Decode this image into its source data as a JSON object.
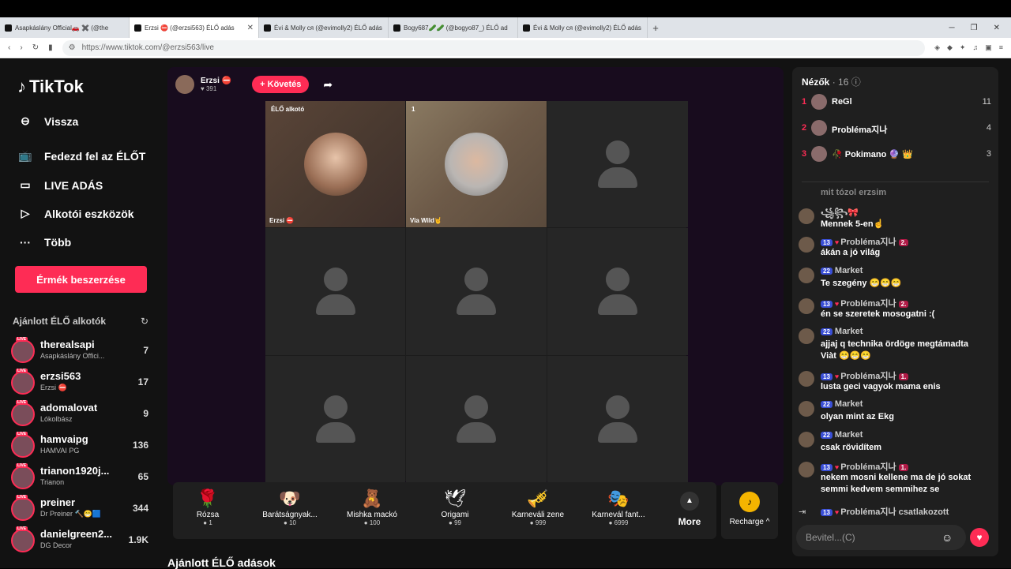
{
  "tabs": [
    {
      "title": "Asapkáslány Official🚗 ✖️ (@the"
    },
    {
      "title": "Erzsi ⛔ (@erzsi563) ÉLŐ adás"
    },
    {
      "title": "Évi & Molly ся (@evimolly2) ÉLŐ adás"
    },
    {
      "title": "Bogy687🥒🥒 (@bogyo87_) ÉLŐ ad"
    },
    {
      "title": "Évi & Molly ся (@evimolly2) ÉLŐ adás"
    }
  ],
  "url": "https://www.tiktok.com/@erzsi563/live",
  "logo": "TikTok",
  "nav": {
    "back": "Vissza",
    "explore": "Fedezd fel az ÉLŐT",
    "live": "LIVE ADÁS",
    "tools": "Alkotói eszközök",
    "more": "Több"
  },
  "coins_button": "Érmék beszerzése",
  "suggested_title": "Ajánlott ÉLŐ alkotók",
  "suggested": [
    {
      "name": "therealsapi",
      "sub": "Asapkáslány Offici...",
      "count": "7"
    },
    {
      "name": "erzsi563",
      "sub": "Erzsi ⛔",
      "count": "17"
    },
    {
      "name": "adomalovat",
      "sub": "Lókolbász",
      "count": "9"
    },
    {
      "name": "hamvaipg",
      "sub": "HAMVAI PG",
      "count": "136"
    },
    {
      "name": "trianon1920j...",
      "sub": "Trianon",
      "count": "65"
    },
    {
      "name": "preiner",
      "sub": "Dr Preiner 🔨😁🟦",
      "count": "344"
    },
    {
      "name": "danielgreen2...",
      "sub": "DG Decor",
      "count": "1.9K"
    }
  ],
  "live_badge": "LIVE",
  "host": {
    "name": "Erzsi ⛔",
    "likes": "♥ 391",
    "follow": "+ Követés"
  },
  "stream": {
    "creator_tag": "ÉLŐ alkotó",
    "host_label": "Erzsi ⛔",
    "guest_tag": "1",
    "guest_label": "Via Wild🤘"
  },
  "gifts": [
    {
      "name": "Rózsa",
      "price": "1",
      "icon": "🌹"
    },
    {
      "name": "Barátságnyak...",
      "price": "10",
      "icon": "🐶"
    },
    {
      "name": "Mishka mackó",
      "price": "100",
      "icon": "🧸"
    },
    {
      "name": "Origami",
      "price": "99",
      "icon": "🕊"
    },
    {
      "name": "Karneváli zene",
      "price": "999",
      "icon": "🎺"
    },
    {
      "name": "Karnevál fant...",
      "price": "6999",
      "icon": "🎭"
    }
  ],
  "more_label": "More",
  "recharge_label": "Recharge ^",
  "bottom_title": "Ajánlott ÉLŐ adások",
  "viewers": {
    "title": "Nézők",
    "count": "· 16",
    "list": [
      {
        "rank": "1",
        "name": "ReGl",
        "score": "11"
      },
      {
        "rank": "2",
        "name": "Probléma지나",
        "score": "4"
      },
      {
        "rank": "3",
        "name": "🥀 Pokimano 🔮 👑",
        "score": "3"
      }
    ]
  },
  "messages": [
    {
      "user": "",
      "badge": "",
      "tag": "",
      "text": "mit tózol erzsim"
    },
    {
      "user": "꧁꧂🎀",
      "badge": "",
      "tag": "",
      "text": "Mennek 5-en☝"
    },
    {
      "user": "Probléma지나",
      "badge": "13",
      "tag": "2.",
      "text": "ákán a jó világ"
    },
    {
      "user": "Market",
      "badge": "22",
      "tag": "",
      "text": "Te szegény 😁😁😁"
    },
    {
      "user": "Probléma지나",
      "badge": "13",
      "tag": "2.",
      "text": "én se szeretek mosogatni :("
    },
    {
      "user": "Market",
      "badge": "22",
      "tag": "",
      "text": "ajjaj q technika ördöge megtámadta Viàt 😁😁😁"
    },
    {
      "user": "Probléma지나",
      "badge": "13",
      "tag": "1.",
      "text": "lusta geci vagyok mama enis"
    },
    {
      "user": "Market",
      "badge": "22",
      "tag": "",
      "text": "olyan mint az Ekg"
    },
    {
      "user": "Market",
      "badge": "22",
      "tag": "",
      "text": "csak rövidítem"
    },
    {
      "user": "Probléma지나",
      "badge": "13",
      "tag": "1.",
      "text": "nekem mosni kellene ma de jó sokat semmi kedvem semmihez se"
    },
    {
      "user": "Probléma지나 csatlakozott",
      "badge": "13",
      "tag": "",
      "text": ""
    }
  ],
  "chat_placeholder": "Bevitel...(C)"
}
